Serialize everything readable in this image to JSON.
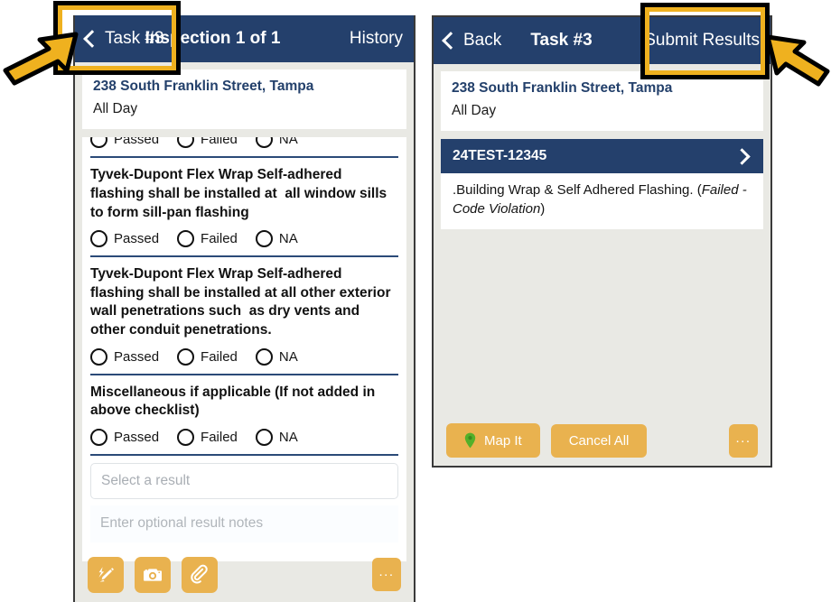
{
  "colors": {
    "navy": "#24406c",
    "orange": "#e9b24f",
    "panel_bg": "#e9e9e4",
    "annotation_yellow": "#efb11f",
    "pin_green": "#53b02a"
  },
  "left_panel": {
    "navbar": {
      "back_label": "Task #3",
      "title": "Inspection 1 of 1",
      "action_label": "History"
    },
    "address": {
      "line1": "238 South Franklin Street, Tampa",
      "line2": "All Day"
    },
    "radio_options": [
      "Passed",
      "Failed",
      "NA"
    ],
    "checklist": [
      {
        "question": "",
        "clipped": true
      },
      {
        "question": "Tyvek-Dupont Flex Wrap Self-adhered flashing shall be installed at  all window sills to form sill-pan flashing"
      },
      {
        "question": "Tyvek-Dupont Flex Wrap Self-adhered flashing shall be installed at all other exterior wall penetrations such  as dry vents and other conduit penetrations."
      },
      {
        "question": "Miscellaneous if applicable (If not added in above checklist)"
      }
    ],
    "inputs": {
      "result_select_placeholder": "Select a result",
      "notes_placeholder": "Enter optional result notes"
    },
    "toolbar": {
      "signature_icon": "pen-signature-icon",
      "camera_icon": "camera-icon",
      "attachment_icon": "paperclip-icon",
      "overflow_label": "..."
    }
  },
  "right_panel": {
    "navbar": {
      "back_label": "Back",
      "title": "Task #3",
      "action_label": "Submit Results"
    },
    "address": {
      "line1": "238 South Franklin Street, Tampa",
      "line2": "All Day"
    },
    "results": [
      {
        "id": "24TEST-12345",
        "summary_prefix": ".Building Wrap & Self Adhered Flashing. (",
        "summary_status": "Failed - Code Violation",
        "summary_suffix": ")"
      }
    ],
    "toolbar": {
      "map_label": "Map It",
      "cancel_label": "Cancel All",
      "overflow_label": "..."
    }
  },
  "annotations": {
    "left_highlight_target": "Task #3",
    "right_highlight_target": "Submit Results"
  }
}
